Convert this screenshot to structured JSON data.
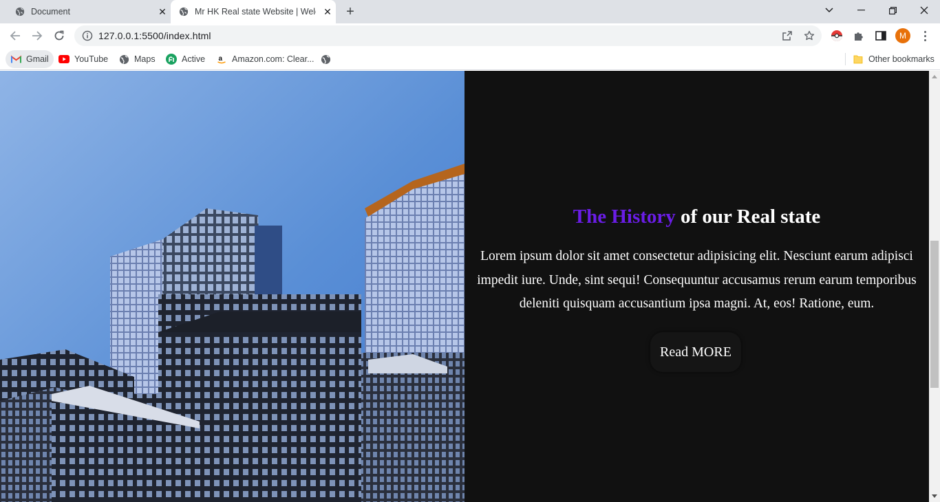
{
  "browser": {
    "tabs": [
      {
        "title": "Document",
        "active": false
      },
      {
        "title": "Mr HK Real state Website | Welcome",
        "active": true
      }
    ],
    "new_tab_label": "+",
    "url": "127.0.0.1:5500/index.html",
    "profile_initial": "M",
    "bookmarks": [
      {
        "label": "Gmail",
        "icon": "gmail-icon"
      },
      {
        "label": "YouTube",
        "icon": "youtube-icon"
      },
      {
        "label": "Maps",
        "icon": "globe-icon"
      },
      {
        "label": "Active",
        "icon": "active-icon"
      },
      {
        "label": "Amazon.com: Clear...",
        "icon": "amazon-icon"
      }
    ],
    "other_bookmarks": "Other bookmarks"
  },
  "page": {
    "history_section": {
      "heading_accent": "The History",
      "heading_rest": " of our Real state",
      "body": "Lorem ipsum dolor sit amet consectetur adipisicing elit. Nesciunt earum adipisci impedit iure. Unde, sint sequi! Consequuntur accusamus rerum earum temporibus deleniti quisquam accusantium ipsa magni. At, eos! Ratione, eum.",
      "button_label": "Read MORE"
    }
  },
  "colors": {
    "accent": "#6a1de6",
    "section_background": "#111111",
    "text": "#ffffff",
    "profile": "#e8710a"
  }
}
